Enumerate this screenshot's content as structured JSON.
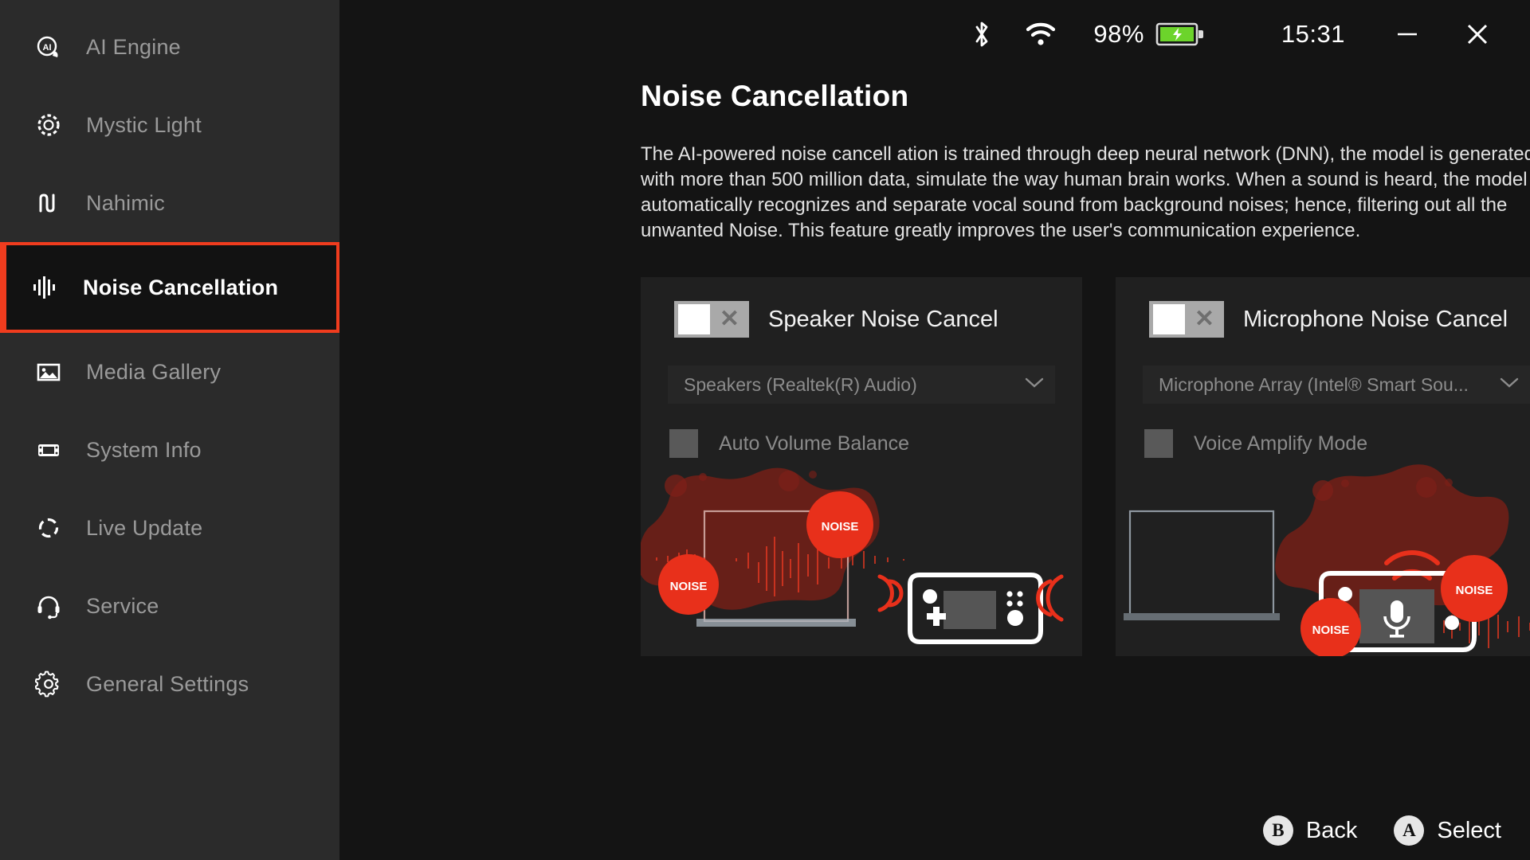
{
  "sidebar": {
    "items": [
      {
        "label": "AI Engine",
        "icon": "ai-engine-icon",
        "active": false
      },
      {
        "label": "Mystic Light",
        "icon": "mystic-light-icon",
        "active": false
      },
      {
        "label": "Nahimic",
        "icon": "nahimic-icon",
        "active": false
      },
      {
        "label": "Noise Cancellation",
        "icon": "sound-wave-icon",
        "active": true
      },
      {
        "label": "Media Gallery",
        "icon": "image-icon",
        "active": false
      },
      {
        "label": "System Info",
        "icon": "handheld-device-icon",
        "active": false
      },
      {
        "label": "Live Update",
        "icon": "refresh-circle-icon",
        "active": false
      },
      {
        "label": "Service",
        "icon": "headset-icon",
        "active": false
      },
      {
        "label": "General Settings",
        "icon": "gear-icon",
        "active": false
      }
    ],
    "active_highlight_color": "#f03c1e"
  },
  "statusbar": {
    "bluetooth_icon": "bluetooth-icon",
    "wifi_icon": "wifi-icon",
    "battery_percent": "98%",
    "battery_icon": "battery-charging-icon",
    "battery_color": "#6cd42b",
    "clock": "15:31",
    "minimize_label": "—",
    "close_label": "✕"
  },
  "main": {
    "title": "Noise Cancellation",
    "description": "The AI-powered noise cancell ation is trained through deep neural network (DNN), the model is generated with more than 500 million data, simulate the way human brain works. When a sound is heard, the model automatically recognizes and separate vocal sound from background noises; hence, filtering out all the unwanted Noise. This feature greatly improves the user's communication experience."
  },
  "panels": [
    {
      "id": "speaker",
      "title": "Speaker Noise Cancel",
      "toggle_state": "off",
      "toggle_mark": "✕",
      "device": "Speakers (Realtek(R) Audio)",
      "option_label": "Auto Volume Balance",
      "option_checked": false,
      "art_noise_labels": [
        "NOISE",
        "NOISE"
      ]
    },
    {
      "id": "microphone",
      "title": "Microphone Noise Cancel",
      "toggle_state": "off",
      "toggle_mark": "✕",
      "device": "Microphone Array (Intel® Smart Sou...",
      "option_label": "Voice Amplify Mode",
      "option_checked": false,
      "art_noise_labels": [
        "NOISE",
        "NOISE"
      ]
    }
  ],
  "bottombar": {
    "hints": [
      {
        "badge": "B",
        "label": "Back"
      },
      {
        "badge": "A",
        "label": "Select"
      }
    ]
  }
}
